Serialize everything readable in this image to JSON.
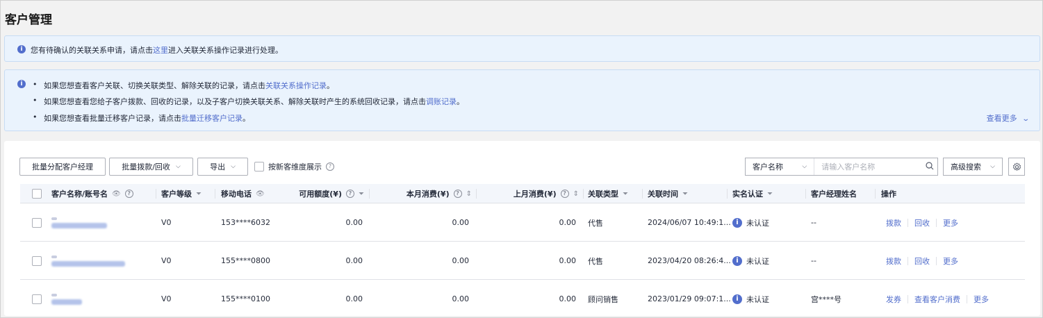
{
  "page": {
    "title": "客户管理"
  },
  "notice1": {
    "text_before": "您有待确认的关联关系申请，请点击",
    "link": "这里",
    "text_after": "进入关联关系操作记录进行处理。"
  },
  "notice2": {
    "items": [
      {
        "text": "如果您想查看客户关联、切换关联类型、解除关联的记录，请点击",
        "link": "关联关系操作记录",
        "suffix": "。"
      },
      {
        "text": "如果您想查看您给子客户拨款、回收的记录，以及子客户切换关联关系、解除关联时产生的系统回收记录，请点击",
        "link": "调账记录",
        "suffix": "。"
      },
      {
        "text": "如果您想查看批量迁移客户记录，请点击",
        "link": "批量迁移客户记录",
        "suffix": "。"
      }
    ],
    "see_more": "查看更多"
  },
  "toolbar": {
    "batch_assign": "批量分配客户经理",
    "batch_fund": "批量拨款/回收",
    "export": "导出",
    "dimension_label": "按新客维度展示",
    "search_field": "客户名称",
    "search_placeholder": "请输入客户名称",
    "advanced": "高级搜索"
  },
  "table": {
    "headers": {
      "name": "客户名称/账号名",
      "level": "客户等级",
      "phone": "移动电话",
      "available": "可用额度(¥)",
      "this_month": "本月消费(¥)",
      "last_month": "上月消费(¥)",
      "relation": "关联类型",
      "time": "关联时间",
      "verify": "实名认证",
      "manager": "客户经理姓名",
      "ops": "操作"
    },
    "rows": [
      {
        "level": "V0",
        "phone": "153****6032",
        "available": "0.00",
        "this_month": "0.00",
        "last_month": "0.00",
        "relation": "代售",
        "time": "2024/06/07 10:49:1...",
        "verify": "未认证",
        "manager": "--",
        "op1": "拨款",
        "op2": "回收",
        "op3": "更多"
      },
      {
        "level": "V0",
        "phone": "155****0800",
        "available": "0.00",
        "this_month": "0.00",
        "last_month": "0.00",
        "relation": "代售",
        "time": "2023/04/20 08:26:4...",
        "verify": "未认证",
        "manager": "--",
        "op1": "拨款",
        "op2": "回收",
        "op3": "更多"
      },
      {
        "level": "V0",
        "phone": "155****0100",
        "available": "0.00",
        "this_month": "0.00",
        "last_month": "0.00",
        "relation": "顾问销售",
        "time": "2023/01/29 09:07:1...",
        "verify": "未认证",
        "manager": "宫****号",
        "op1": "发券",
        "op2": "查看客户消费",
        "op3": "更多"
      }
    ]
  },
  "colors": {
    "accent": "#526ecc",
    "notice_bg": "#eaf3fd",
    "header_bg": "#f3f6fb"
  }
}
